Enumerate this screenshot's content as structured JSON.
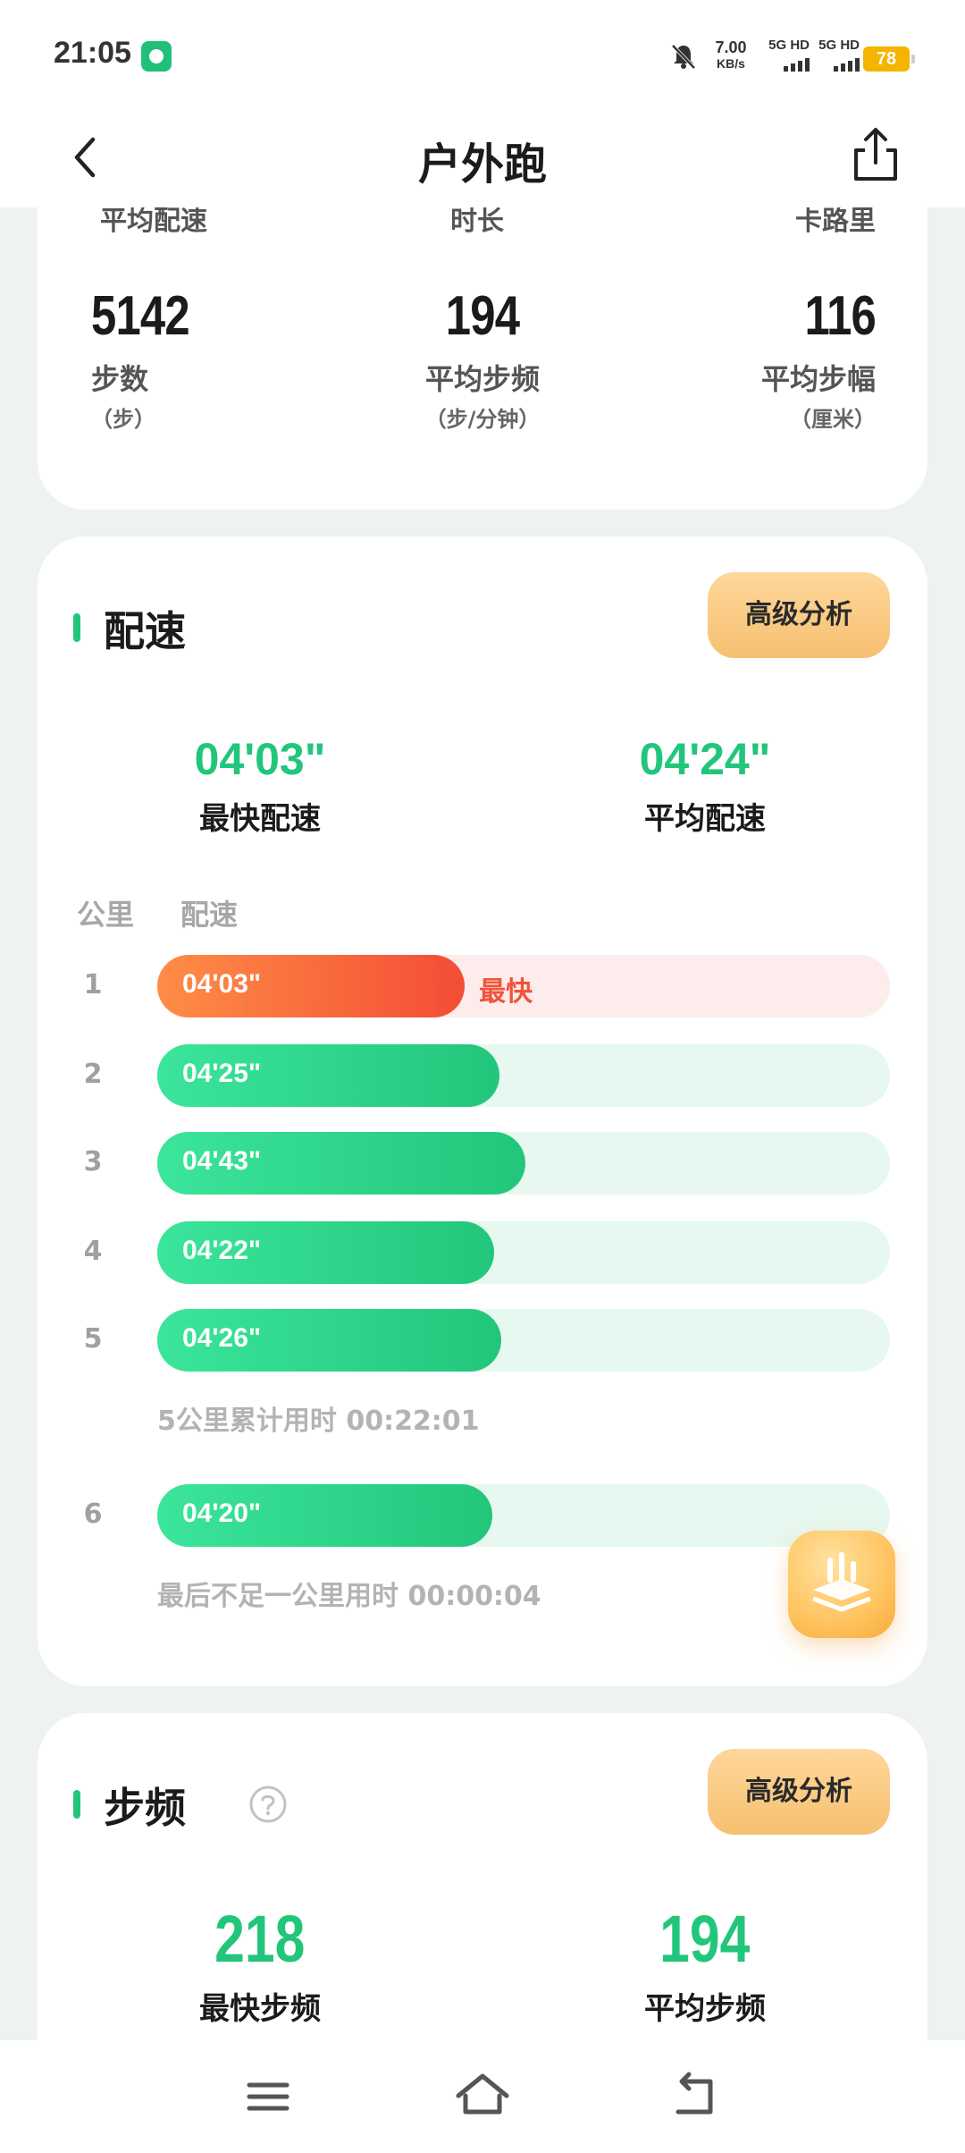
{
  "status_bar": {
    "time": "21:05",
    "net_speed_value": "7.00",
    "net_speed_unit": "KB/s",
    "sim1_label": "5G HD",
    "sim2_label": "5G HD",
    "battery": "78",
    "colors": {
      "battery": "#f5b400",
      "app_badge": "#21c07a"
    },
    "icons": [
      "app-badge-icon",
      "bell-muted-icon",
      "signal-icon",
      "battery-icon"
    ]
  },
  "header": {
    "title": "户外跑",
    "icons": [
      "back-icon",
      "share-icon"
    ]
  },
  "stats_card": {
    "partial_labels": [
      "平均配速",
      "时长",
      "卡路里"
    ],
    "items": [
      {
        "value": "5142",
        "label": "步数",
        "unit": "（步）"
      },
      {
        "value": "194",
        "label": "平均步频",
        "unit": "（步/分钟）"
      },
      {
        "value": "116",
        "label": "平均步幅",
        "unit": "（厘米）"
      }
    ]
  },
  "pace_card": {
    "title": "配速",
    "advanced_button": "高级分析",
    "fastest_value": "04'03\"",
    "fastest_label": "最快配速",
    "average_value": "04'24\"",
    "average_label": "平均配速",
    "col_km": "公里",
    "col_pace": "配速",
    "fastest_tag": "最快",
    "rows": [
      {
        "km": "1",
        "pace": "04'03\"",
        "fill": 0.42,
        "fastest": true
      },
      {
        "km": "2",
        "pace": "04'25\"",
        "fill": 0.467,
        "fastest": false
      },
      {
        "km": "3",
        "pace": "04'43\"",
        "fill": 0.502,
        "fastest": false
      },
      {
        "km": "4",
        "pace": "04'22\"",
        "fill": 0.46,
        "fastest": false
      },
      {
        "km": "5",
        "pace": "04'26\"",
        "fill": 0.469,
        "fastest": false
      },
      {
        "km": "6",
        "pace": "04'20\"",
        "fill": 0.457,
        "fastest": false
      }
    ],
    "five_km_note": "5公里累计用时 00:22:01",
    "last_note": "最后不足一公里用时 00:00:04",
    "colors": {
      "accent": "#22c67b",
      "fastest": "#f34d36",
      "track": "#e7f8f0",
      "fast_track": "#fdecec"
    }
  },
  "cadence_card": {
    "title": "步频",
    "advanced_button": "高级分析",
    "fastest_value": "218",
    "fastest_label": "最快步频",
    "average_value": "194",
    "average_label": "平均步频",
    "icons": [
      "help-icon"
    ]
  },
  "float_button": {
    "icon": "analysis-icon"
  },
  "nav_bar": {
    "icons": [
      "menu-icon",
      "home-icon",
      "back-nav-icon"
    ]
  }
}
